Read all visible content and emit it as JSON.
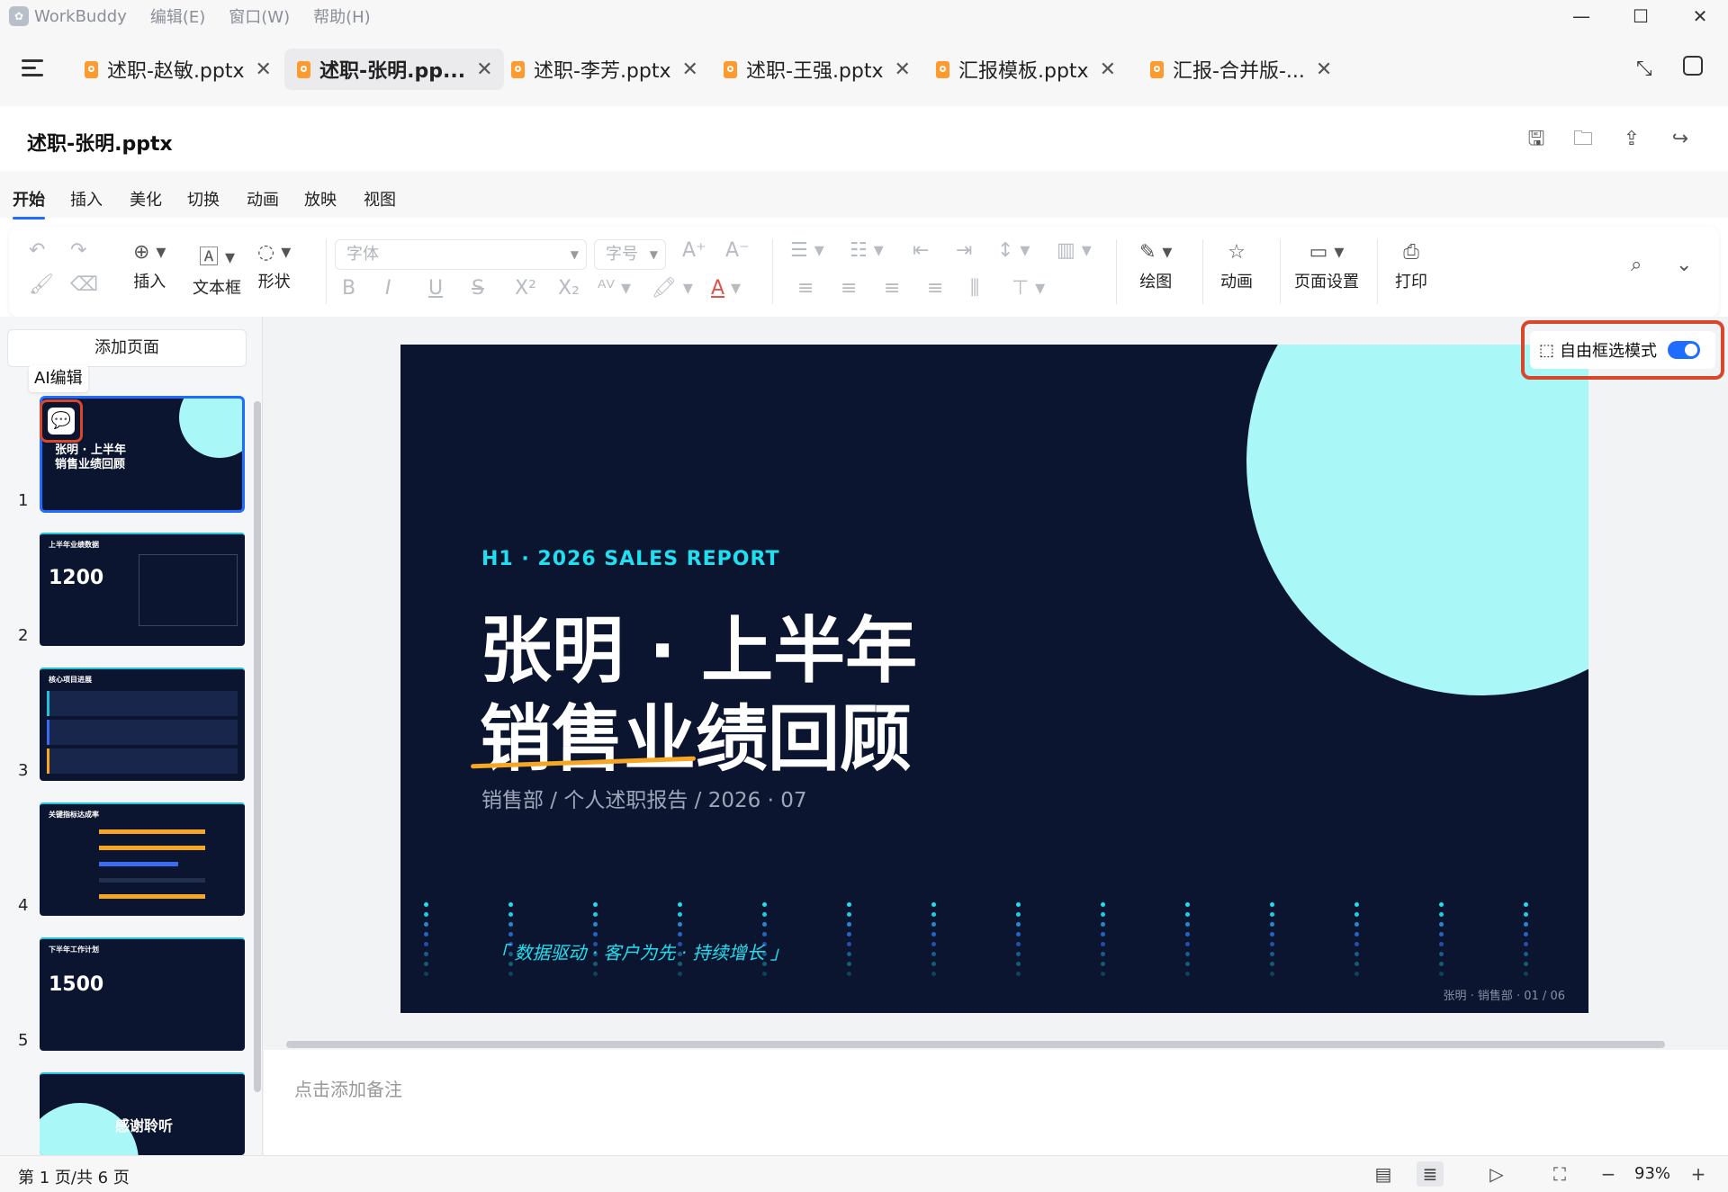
{
  "app": {
    "name": "WorkBuddy",
    "menus": [
      "编辑(E)",
      "窗口(W)",
      "帮助(H)"
    ]
  },
  "tabs": [
    {
      "label": "述职-赵敏.pptx",
      "active": false
    },
    {
      "label": "述职-张明.pp...",
      "active": true
    },
    {
      "label": "述职-李芳.pptx",
      "active": false
    },
    {
      "label": "述职-王强.pptx",
      "active": false
    },
    {
      "label": "汇报模板.pptx",
      "active": false
    },
    {
      "label": "汇报-合并版-...",
      "active": false
    }
  ],
  "document": {
    "title": "述职-张明.pptx"
  },
  "ribbon_tabs": [
    "开始",
    "插入",
    "美化",
    "切换",
    "动画",
    "放映",
    "视图"
  ],
  "toolbar": {
    "insert_label": "插入",
    "textbox_label": "文本框",
    "shape_label": "形状",
    "font_placeholder": "字体",
    "size_placeholder": "字号",
    "draw_label": "绘图",
    "animation_label": "动画",
    "page_setup_label": "页面设置",
    "print_label": "打印"
  },
  "left_panel": {
    "add_page_label": "添加页面",
    "ai_edit_tooltip": "AI编辑",
    "thumbnails": [
      {
        "num": "1",
        "title": "张明 · 上半年\n销售业绩回顾"
      },
      {
        "num": "2",
        "title": "上半年业绩数据",
        "big": "1200"
      },
      {
        "num": "3",
        "title": "核心项目进展"
      },
      {
        "num": "4",
        "title": "关键指标达成率"
      },
      {
        "num": "5",
        "title": "下半年工作计划",
        "big": "1500"
      },
      {
        "num": "",
        "title": "感谢聆听"
      }
    ]
  },
  "slide": {
    "kicker": "H1 · 2026  SALES  REPORT",
    "title_line1": "张明 · 上半年",
    "title_line2": "销售业绩回顾",
    "subtitle": "销售部  /  个人述职报告  /  2026 · 07",
    "slogan": "「 数据驱动 · 客户为先 · 持续增长 」",
    "footer": "张明 · 销售部 · 01 / 06",
    "colors": {
      "background": "#0c1530",
      "accent_cyan": "#1ee0f0",
      "circle": "#aaf7f7",
      "underline": "#f5a623"
    }
  },
  "free_select": {
    "label": "自由框选模式",
    "enabled": true
  },
  "notes": {
    "placeholder": "点击添加备注"
  },
  "status": {
    "page_info": "第 1 页/共 6 页",
    "zoom": "93%"
  }
}
